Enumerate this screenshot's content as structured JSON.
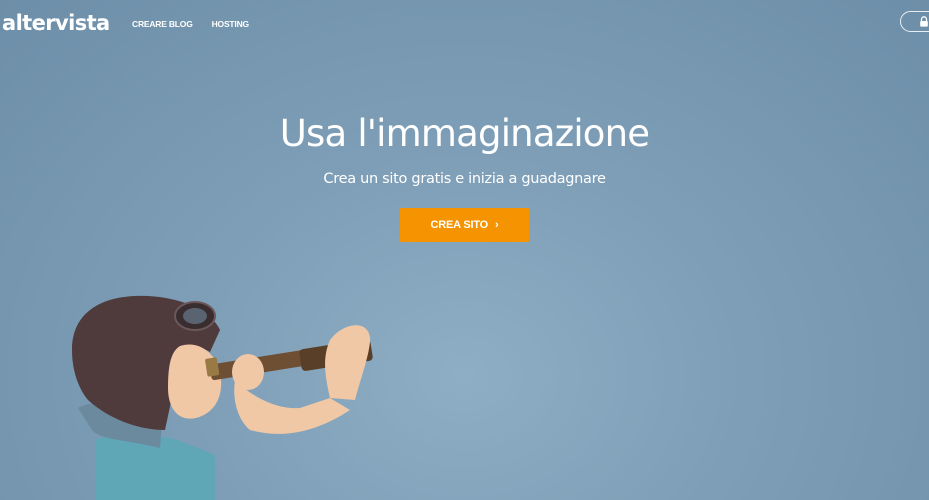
{
  "header": {
    "logo": "altervista",
    "nav": [
      {
        "label": "CREARE BLOG"
      },
      {
        "label": "HOSTING"
      }
    ],
    "login_icon": "lock-icon"
  },
  "hero": {
    "title": "Usa l'immaginazione",
    "subtitle": "Crea un sito gratis e inizia a guadagnare",
    "cta_label": "CREA SITO",
    "cta_icon": "chevron-right-icon"
  },
  "colors": {
    "background": "#7f9fb8",
    "cta": "#f59300",
    "text": "#ffffff"
  }
}
